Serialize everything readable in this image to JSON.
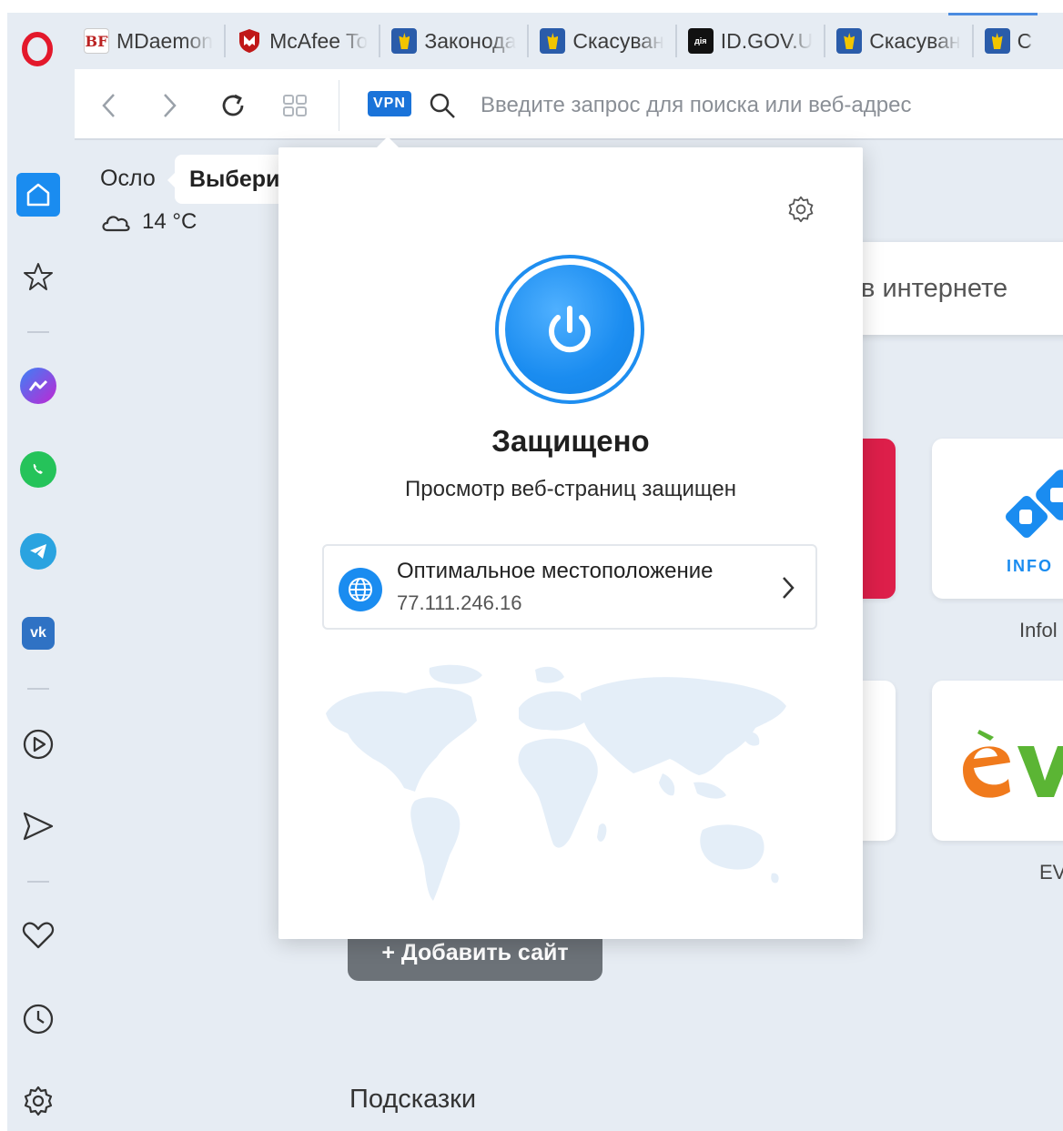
{
  "browser": {
    "tabs": [
      {
        "title": "MDaemon",
        "favicon": "mdaemon-icon"
      },
      {
        "title": "McAfee To",
        "favicon": "mcafee-shield-icon"
      },
      {
        "title": "Законода",
        "favicon": "ukraine-trident-icon"
      },
      {
        "title": "Скасуван",
        "favicon": "ukraine-trident-icon"
      },
      {
        "title": "ID.GOV.U",
        "favicon": "diia-icon"
      },
      {
        "title": "Скасуван",
        "favicon": "ukraine-trident-icon"
      },
      {
        "title": "С",
        "favicon": "ukraine-trident-icon"
      }
    ],
    "diia_badge": "дія",
    "vpn_badge": "VPN",
    "address_placeholder": "Введите запрос для поиска или веб-адрес"
  },
  "sidebar": {
    "items": [
      "home-icon",
      "bookmark-star-icon",
      "messenger-icon",
      "whatsapp-icon",
      "telegram-icon",
      "vk-icon",
      "player-icon",
      "send-icon",
      "heart-icon",
      "history-clock-icon",
      "settings-gear-icon"
    ],
    "vk_label": "vk"
  },
  "start_page": {
    "weather_city": "Осло",
    "weather_chip": "Выбери",
    "weather_temp": "14 °C",
    "search_text": "в интернете",
    "tiles": [
      {
        "label": "Infol"
      },
      {
        "label": "EV"
      }
    ],
    "tile_logo_text": "INFO",
    "add_site": "+ Добавить сайт",
    "hints_title": "Подсказки"
  },
  "vpn_popup": {
    "status_title": "Защищено",
    "status_subtitle": "Просмотр веб-страниц защищен",
    "location_name": "Оптимальное местоположение",
    "location_ip": "77.111.246.16"
  },
  "colors": {
    "accent": "#1a8cf0",
    "opera_red": "#e3182b",
    "background": "#e6ecf3"
  }
}
